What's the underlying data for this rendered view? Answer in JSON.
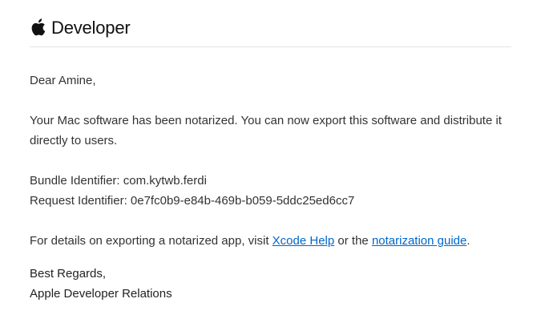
{
  "header": {
    "brand_icon": "apple-logo-icon",
    "brand_text": "Developer"
  },
  "email": {
    "greeting": "Dear Amine,",
    "body": "Your Mac software has been notarized. You can now export this software and distribute it directly to users.",
    "bundle_identifier": "Bundle Identifier: com.kytwb.ferdi",
    "request_identifier": "Request Identifier: 0e7fc0b9-e84b-469b-b059-5ddc25ed6cc7",
    "details_prefix": "For details on exporting a notarized app, visit ",
    "link_xcode_help": "Xcode Help",
    "details_middle": " or the ",
    "link_notarization_guide": "notarization guide",
    "details_suffix": ".",
    "signoff_line1": "Best Regards,",
    "signoff_line2": "Apple Developer Relations"
  },
  "colors": {
    "link": "#0066cc",
    "text": "#333333",
    "divider": "#e3e3e3"
  }
}
